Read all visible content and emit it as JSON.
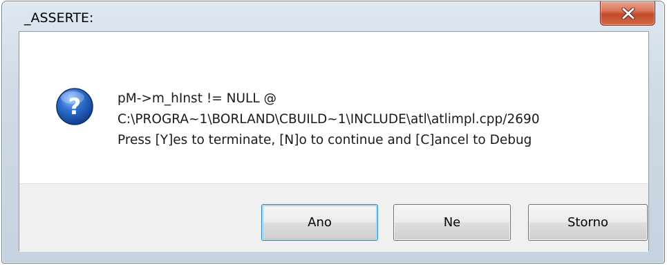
{
  "window": {
    "title": "_ASSERTE:"
  },
  "icons": {
    "close": "close-icon",
    "question": "question-icon"
  },
  "message": {
    "lines": [
      "pM->m_hInst != NULL @",
      "C:\\PROGRA~1\\BORLAND\\CBUILD~1\\INCLUDE\\atl\\atlimpl.cpp/2690",
      "Press [Y]es to terminate, [N]o to continue and [C]ancel to Debug"
    ]
  },
  "buttons": {
    "yes": "Ano",
    "no": "Ne",
    "cancel": "Storno"
  },
  "colors": {
    "close_button": "#d0694a",
    "question_icon": "#2a5fb8",
    "default_button_border": "#3c7fb1"
  }
}
